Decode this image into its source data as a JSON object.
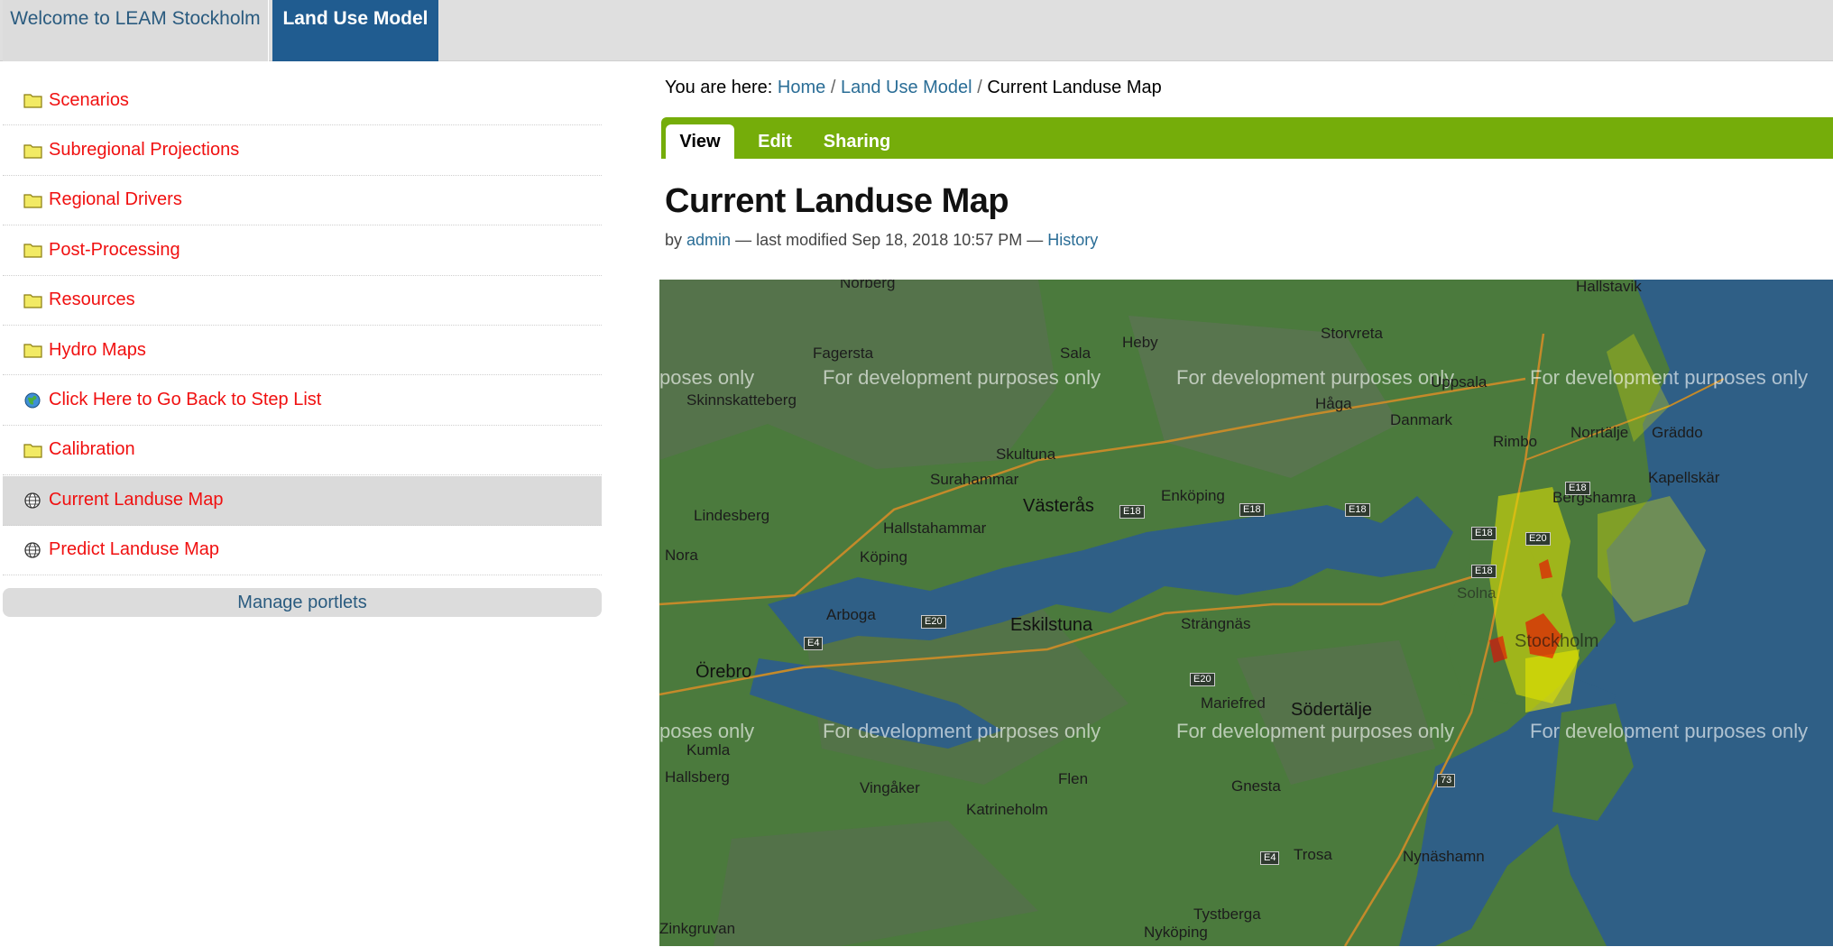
{
  "top_tabs": [
    {
      "label": "Welcome to LEAM Stockholm",
      "active": false
    },
    {
      "label": "Land Use Model",
      "active": true
    }
  ],
  "sidebar": {
    "items": [
      {
        "label": "Scenarios",
        "icon": "folder-icon"
      },
      {
        "label": "Subregional Projections",
        "icon": "folder-icon"
      },
      {
        "label": "Regional Drivers",
        "icon": "folder-icon"
      },
      {
        "label": "Post-Processing",
        "icon": "folder-icon"
      },
      {
        "label": "Resources",
        "icon": "folder-icon"
      },
      {
        "label": "Hydro Maps",
        "icon": "folder-icon"
      },
      {
        "label": "Click Here to Go Back to Step List",
        "icon": "globe-icon"
      },
      {
        "label": "Calibration",
        "icon": "folder-icon"
      },
      {
        "label": "Current Landuse Map",
        "icon": "map-globe-icon",
        "current": true
      },
      {
        "label": "Predict Landuse Map",
        "icon": "map-globe-icon"
      }
    ],
    "manage_portlets": "Manage portlets"
  },
  "breadcrumb": {
    "prefix": "You are here:",
    "items": [
      "Home",
      "Land Use Model",
      "Current Landuse Map"
    ],
    "separator": "/"
  },
  "content_tabs": [
    {
      "label": "View",
      "active": true
    },
    {
      "label": "Edit",
      "active": false
    },
    {
      "label": "Sharing",
      "active": false
    }
  ],
  "page": {
    "title": "Current Landuse Map",
    "byline_by": "by",
    "author": "admin",
    "modified": "— last modified Sep 18, 2018 10:57 PM —",
    "history": "History"
  },
  "map": {
    "watermark": "For development purposes only",
    "watermark_partial": "poses only",
    "places": [
      "Norberg",
      "Fagersta",
      "Sala",
      "Heby",
      "Storvreta",
      "Hallstavik",
      "Skinnskatteberg",
      "Uppsala",
      "Håga",
      "Danmark",
      "Rimbo",
      "Norrtälje",
      "Gräddo",
      "Skultuna",
      "Surahammar",
      "Kapellskär",
      "Bergshamra",
      "Västerås",
      "Enköping",
      "Lindesberg",
      "Hallstahammar",
      "Köping",
      "Nora",
      "Arboga",
      "Eskilstuna",
      "Strängnäs",
      "Stockholm",
      "Solna",
      "Örebro",
      "Mariefred",
      "Södertälje",
      "Kumla",
      "Hallsberg",
      "Flen",
      "Gnesta",
      "Vingåker",
      "Katrineholm",
      "Trosa",
      "Nynäshamn",
      "Tystberga",
      "Zinkgruvan",
      "Nyköping"
    ],
    "roads": [
      "E18",
      "E20",
      "E4",
      "E18",
      "E18",
      "E20",
      "E18",
      "E18",
      "E18",
      "E20",
      "E4",
      "73"
    ],
    "colors": {
      "land": "#4b7a3d",
      "water": "#2f5f86",
      "urban": "#e6e600",
      "dense": "#f00000"
    }
  }
}
